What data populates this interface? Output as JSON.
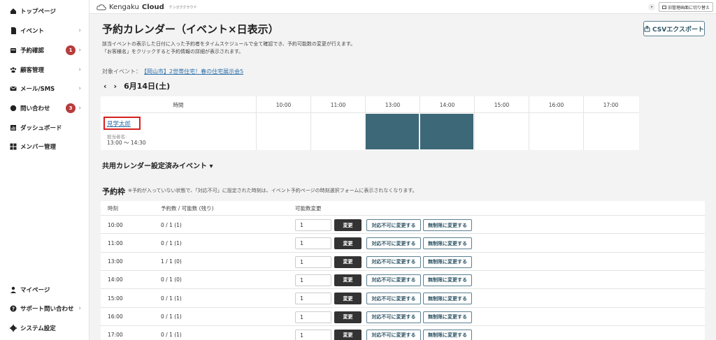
{
  "sidebar": {
    "items": [
      {
        "label": "トップページ",
        "icon": "home-icon",
        "chevron": false,
        "badge": ""
      },
      {
        "label": "イベント",
        "icon": "document-icon",
        "chevron": true,
        "badge": ""
      },
      {
        "label": "予約確認",
        "icon": "calendar-icon",
        "chevron": true,
        "badge": "1"
      },
      {
        "label": "顧客管理",
        "icon": "users-icon",
        "chevron": true,
        "badge": ""
      },
      {
        "label": "メール/SMS",
        "icon": "mail-icon",
        "chevron": true,
        "badge": ""
      },
      {
        "label": "問い合わせ",
        "icon": "chat-icon",
        "chevron": true,
        "badge": "3"
      },
      {
        "label": "ダッシュボード",
        "icon": "chart-icon",
        "chevron": false,
        "badge": ""
      },
      {
        "label": "メンバー管理",
        "icon": "grid-icon",
        "chevron": false,
        "badge": ""
      }
    ],
    "bottom_items": [
      {
        "label": "マイページ",
        "icon": "person-icon",
        "chevron": false
      },
      {
        "label": "サポート問い合わせ",
        "icon": "help-icon",
        "chevron": true
      },
      {
        "label": "システム設定",
        "icon": "gear-icon",
        "chevron": false
      }
    ]
  },
  "topbar": {
    "logo_text": "Kengaku",
    "logo_bold": "Cloud",
    "logo_sub": "ケンガククラウド",
    "switch_label": "旧管理画面に切り替え"
  },
  "page": {
    "title": "予約カレンダー（イベント×日表示）",
    "csv_button": "CSVエクスポート",
    "desc1": "該当イベントの表示した日付に入った予約者をタイムスケジュールで全て確認でき、予約可能数の変更が行えます。",
    "desc2": "「お客様名」をクリックすると予約情報の詳細が表示されます。",
    "target_label": "対象イベント：",
    "target_event": "【岡山市】2世帯住宅！春の住宅展示会5",
    "prev": "‹",
    "next": "›",
    "date": "6月14日(土)"
  },
  "calendar": {
    "time_header": "時間",
    "hours": [
      "10:00",
      "11:00",
      "13:00",
      "14:00",
      "15:00",
      "16:00",
      "17:00"
    ],
    "booked_hours": [
      "13:00",
      "14:00"
    ],
    "booking": {
      "name": "見学太郎",
      "staff_label": "担当者名:",
      "time_range": "13:00 〜 14:30"
    },
    "booked_color": "#3d6878"
  },
  "shared": {
    "label": "共用カレンダー設定済みイベント ▾"
  },
  "slots": {
    "title": "予約枠",
    "note": "※予約が入っていない状態で、「対応不可」に設定された時刻は、イベント予約ページの時刻選択フォームに表示されなくなります。",
    "headers": {
      "time": "時刻",
      "count": "予約数 / 可能数 (残り)",
      "change": "可能数変更"
    },
    "change_button": "変更",
    "unavailable_button": "対応不可に変更する",
    "unlimited_button": "無制限に変更する",
    "rows": [
      {
        "time": "10:00",
        "count": "0 / 1 (1)",
        "qty": "1"
      },
      {
        "time": "11:00",
        "count": "0 / 1 (1)",
        "qty": "1"
      },
      {
        "time": "13:00",
        "count": "1 / 1 (0)",
        "qty": "1"
      },
      {
        "time": "14:00",
        "count": "0 / 1 (0)",
        "qty": "1"
      },
      {
        "time": "15:00",
        "count": "0 / 1 (1)",
        "qty": "1"
      },
      {
        "time": "16:00",
        "count": "0 / 1 (1)",
        "qty": "1"
      },
      {
        "time": "17:00",
        "count": "0 / 1 (1)",
        "qty": "1"
      }
    ]
  }
}
